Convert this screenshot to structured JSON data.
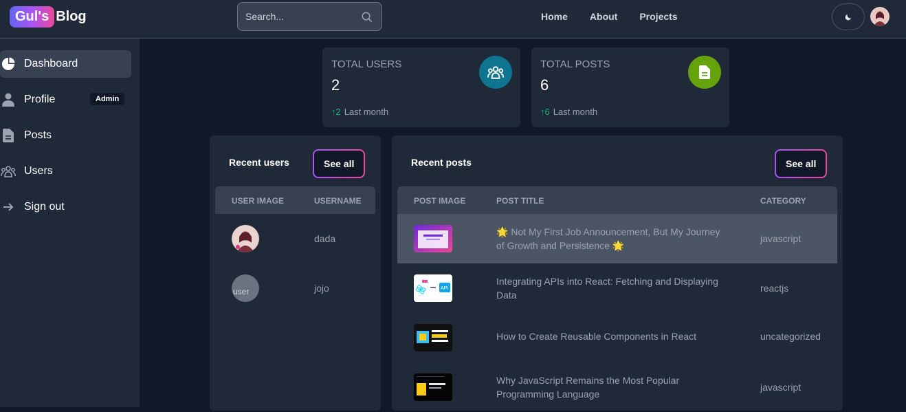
{
  "header": {
    "logo_badge": "Gul's",
    "logo_text": "Blog",
    "search_placeholder": "Search...",
    "nav": [
      "Home",
      "About",
      "Projects"
    ]
  },
  "sidebar": {
    "items": [
      {
        "label": "Dashboard",
        "icon": "pie-chart-icon"
      },
      {
        "label": "Profile",
        "icon": "user-icon",
        "badge": "Admin"
      },
      {
        "label": "Posts",
        "icon": "document-icon"
      },
      {
        "label": "Users",
        "icon": "users-group-icon"
      },
      {
        "label": "Sign out",
        "icon": "arrow-right-icon"
      }
    ]
  },
  "stats": [
    {
      "label": "TOTAL USERS",
      "value": "2",
      "delta": "2",
      "period": "Last month",
      "icon": "users-group-icon",
      "color": "#0e7490"
    },
    {
      "label": "TOTAL POSTS",
      "value": "6",
      "delta": "6",
      "period": "Last month",
      "icon": "document-icon",
      "color": "#65a30d"
    }
  ],
  "recent_users": {
    "title": "Recent users",
    "see_all": "See all",
    "columns": [
      "USER IMAGE",
      "USERNAME"
    ],
    "rows": [
      {
        "username": "dada",
        "image_alt": ""
      },
      {
        "username": "jojo",
        "image_alt": "user"
      }
    ]
  },
  "recent_posts": {
    "title": "Recent posts",
    "see_all": "See all",
    "columns": [
      "POST IMAGE",
      "POST TITLE",
      "CATEGORY"
    ],
    "rows": [
      {
        "title": "🌟 Not My First Job Announcement, But My Journey of Growth and Persistence 🌟",
        "category": "javascript"
      },
      {
        "title": "Integrating APIs into React: Fetching and Displaying Data",
        "category": "reactjs"
      },
      {
        "title": "How to Create Reusable Components in React",
        "category": "uncategorized"
      },
      {
        "title": "Why JavaScript Remains the Most Popular Programming Language",
        "category": "javascript"
      }
    ]
  },
  "colors": {
    "accent_gradient_start": "#a855f7",
    "accent_gradient_end": "#ec4899",
    "up": "#10b981"
  }
}
